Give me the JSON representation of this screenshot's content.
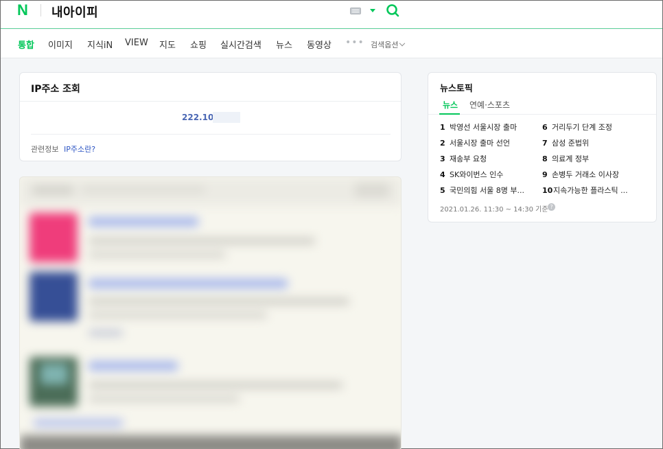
{
  "header": {
    "logo": "N",
    "query": "내아이피"
  },
  "tabs": {
    "items": [
      "통합",
      "이미지",
      "지식iN",
      "VIEW",
      "지도",
      "쇼핑",
      "실시간검색",
      "뉴스",
      "동영상"
    ],
    "more": "•••",
    "options": "검색옵션"
  },
  "ip_card": {
    "title": "IP주소 조회",
    "ip_value": "222.102",
    "related_label": "관련정보",
    "related_link": "IP주소란?"
  },
  "news_topic": {
    "title": "뉴스토픽",
    "tabs": [
      "뉴스",
      "연예·스포츠"
    ],
    "items": [
      {
        "rank": "1",
        "text": "박영선 서울시장 출마"
      },
      {
        "rank": "2",
        "text": "서울시장 출마 선언"
      },
      {
        "rank": "3",
        "text": "재송부 요청"
      },
      {
        "rank": "4",
        "text": "SK와이번스 인수"
      },
      {
        "rank": "5",
        "text": "국민의힘 서울 8명 부..."
      },
      {
        "rank": "6",
        "text": "거리두기 단계 조정"
      },
      {
        "rank": "7",
        "text": "삼성 준법위"
      },
      {
        "rank": "8",
        "text": "의료계 정부"
      },
      {
        "rank": "9",
        "text": "손병두 거래소 이사장"
      },
      {
        "rank": "10",
        "text": "지속가능한 플라스틱 ..."
      }
    ],
    "time": "2021.01.26. 11:30 ~ 14:30 기준",
    "help": "?"
  },
  "colors": {
    "brand": "#03c75a",
    "link": "#2d55c3",
    "ip": "#4a67b4"
  }
}
